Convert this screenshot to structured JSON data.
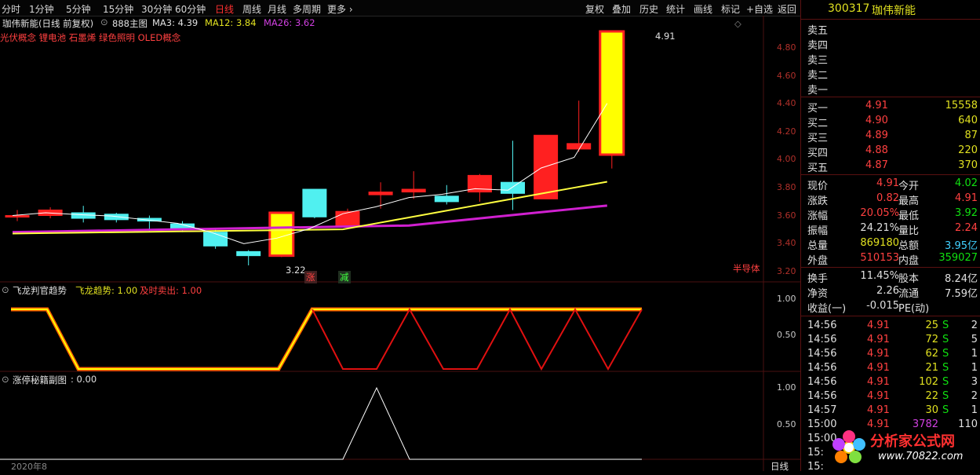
{
  "toolbar": {
    "periods": [
      "分时",
      "1分钟",
      "5分钟",
      "15分钟",
      "30分钟",
      "60分钟",
      "日线",
      "周线",
      "月线",
      "多周期",
      "更多"
    ],
    "active_period": "日线",
    "actions": [
      "复权",
      "叠加",
      "历史",
      "统计",
      "画线",
      "标记",
      "+自选",
      "返回"
    ]
  },
  "main_chart": {
    "title": "珈伟新能(日线 前复权)",
    "template": "888主图",
    "ma3": "MA3: 4.39",
    "ma12": "MA12: 3.84",
    "ma26": "MA26: 3.62",
    "concepts": "光伏概念 锂电池 石墨烯 绿色照明 OLED概念",
    "price_axis": [
      "4.80",
      "4.60",
      "4.40",
      "4.20",
      "4.00",
      "3.80",
      "3.60",
      "3.40",
      "3.20"
    ],
    "high_label": "4.91",
    "low_label": "3.22",
    "marker_zhang": "涨",
    "marker_jian": "减",
    "sector_label": "半导体"
  },
  "indicator1": {
    "name": "飞龙判官趋势",
    "trend_label": "飞龙趋势: 1.00",
    "sell_label": "及时卖出: 1.00",
    "axis": [
      "1.00",
      "0.50"
    ]
  },
  "indicator2": {
    "name": "涨停秘籍副图",
    "value_label": ": 0.00",
    "axis": [
      "1.00",
      "0.50"
    ]
  },
  "bottom": {
    "date_label": "2020年8",
    "period_label": "日线"
  },
  "chart_data": {
    "type": "candlestick",
    "candles": [
      {
        "o": 3.58,
        "c": 3.58,
        "h": 3.62,
        "l": 3.54,
        "up": true
      },
      {
        "o": 3.58,
        "c": 3.62,
        "h": 3.64,
        "l": 3.56,
        "up": true
      },
      {
        "o": 3.6,
        "c": 3.56,
        "h": 3.65,
        "l": 3.53,
        "up": false
      },
      {
        "o": 3.59,
        "c": 3.55,
        "h": 3.6,
        "l": 3.53,
        "up": true
      },
      {
        "o": 3.56,
        "c": 3.54,
        "h": 3.58,
        "l": 3.46,
        "up": false
      },
      {
        "o": 3.52,
        "c": 3.48,
        "h": 3.54,
        "l": 3.46,
        "up": false
      },
      {
        "o": 3.46,
        "c": 3.36,
        "h": 3.48,
        "l": 3.34,
        "up": false
      },
      {
        "o": 3.32,
        "c": 3.29,
        "h": 3.33,
        "l": 3.22,
        "up": false
      },
      {
        "o": 3.29,
        "c": 3.6,
        "h": 3.6,
        "l": 3.28,
        "up": true
      },
      {
        "o": 3.77,
        "c": 3.57,
        "h": 3.77,
        "l": 3.56,
        "up": false
      },
      {
        "o": 3.5,
        "c": 3.61,
        "h": 3.63,
        "l": 3.49,
        "up": true
      },
      {
        "o": 3.73,
        "c": 3.75,
        "h": 3.82,
        "l": 3.63,
        "up": true
      },
      {
        "o": 3.75,
        "c": 3.77,
        "h": 3.9,
        "l": 3.7,
        "up": true
      },
      {
        "o": 3.72,
        "c": 3.68,
        "h": 3.8,
        "l": 3.66,
        "up": false
      },
      {
        "o": 3.75,
        "c": 3.87,
        "h": 3.88,
        "l": 3.68,
        "up": true
      },
      {
        "o": 3.82,
        "c": 3.74,
        "h": 4.12,
        "l": 3.62,
        "up": false
      },
      {
        "o": 3.7,
        "c": 4.16,
        "h": 4.16,
        "l": 3.7,
        "up": true
      },
      {
        "o": 4.06,
        "c": 4.1,
        "h": 4.41,
        "l": 4.04,
        "up": true
      },
      {
        "o": 4.02,
        "c": 4.91,
        "h": 4.91,
        "l": 3.92,
        "up": true
      }
    ]
  },
  "order_book": {
    "code": "300317",
    "name": "珈伟新能",
    "sells": [
      {
        "label": "卖五",
        "price": "",
        "vol": ""
      },
      {
        "label": "卖四",
        "price": "",
        "vol": ""
      },
      {
        "label": "卖三",
        "price": "",
        "vol": ""
      },
      {
        "label": "卖二",
        "price": "",
        "vol": ""
      },
      {
        "label": "卖一",
        "price": "",
        "vol": ""
      }
    ],
    "buys": [
      {
        "label": "买一",
        "price": "4.91",
        "vol": "15558"
      },
      {
        "label": "买二",
        "price": "4.90",
        "vol": "640"
      },
      {
        "label": "买三",
        "price": "4.89",
        "vol": "87"
      },
      {
        "label": "买四",
        "price": "4.88",
        "vol": "220"
      },
      {
        "label": "买五",
        "price": "4.87",
        "vol": "370"
      }
    ],
    "stats": [
      {
        "k1": "现价",
        "v1": "4.91",
        "c1": "red",
        "k2": "今开",
        "v2": "4.02",
        "c2": "green"
      },
      {
        "k1": "涨跌",
        "v1": "0.82",
        "c1": "red",
        "k2": "最高",
        "v2": "4.91",
        "c2": "red"
      },
      {
        "k1": "涨幅",
        "v1": "20.05%",
        "c1": "red",
        "k2": "最低",
        "v2": "3.92",
        "c2": "green"
      },
      {
        "k1": "振幅",
        "v1": "24.21%",
        "c1": "white",
        "k2": "量比",
        "v2": "2.24",
        "c2": "red"
      },
      {
        "k1": "总量",
        "v1": "869180",
        "c1": "yellow",
        "k2": "总额",
        "v2": "3.95亿",
        "c2": "cyan"
      },
      {
        "k1": "外盘",
        "v1": "510153",
        "c1": "red",
        "k2": "内盘",
        "v2": "359027",
        "c2": "green"
      }
    ],
    "stats2": [
      {
        "k1": "换手",
        "v1": "11.45%",
        "k2": "股本",
        "v2": "8.24亿"
      },
      {
        "k1": "净资",
        "v1": "2.26",
        "k2": "流通",
        "v2": "7.59亿"
      },
      {
        "k1": "收益(一)",
        "v1": "-0.015",
        "k2": "PE(动)",
        "v2": ""
      }
    ],
    "ticks": [
      {
        "t": "14:56",
        "p": "4.91",
        "v": "25",
        "s": "S",
        "n": "2"
      },
      {
        "t": "14:56",
        "p": "4.91",
        "v": "72",
        "s": "S",
        "n": "5"
      },
      {
        "t": "14:56",
        "p": "4.91",
        "v": "62",
        "s": "S",
        "n": "1"
      },
      {
        "t": "14:56",
        "p": "4.91",
        "v": "21",
        "s": "S",
        "n": "1"
      },
      {
        "t": "14:56",
        "p": "4.91",
        "v": "102",
        "s": "S",
        "n": "3"
      },
      {
        "t": "14:56",
        "p": "4.91",
        "v": "22",
        "s": "S",
        "n": "2"
      },
      {
        "t": "14:57",
        "p": "4.91",
        "v": "30",
        "s": "S",
        "n": "1"
      },
      {
        "t": "15:00",
        "p": "4.91",
        "v": "3782",
        "s": "",
        "n": "110"
      },
      {
        "t": "15:00",
        "p": "",
        "v": "",
        "s": "",
        "n": ""
      },
      {
        "t": "15:",
        "p": "",
        "v": "",
        "s": "",
        "n": ""
      },
      {
        "t": "15:",
        "p": "",
        "v": "",
        "s": "",
        "n": ""
      }
    ],
    "watermark_text": "分析家公式网",
    "watermark_url": "www.70822.com"
  }
}
